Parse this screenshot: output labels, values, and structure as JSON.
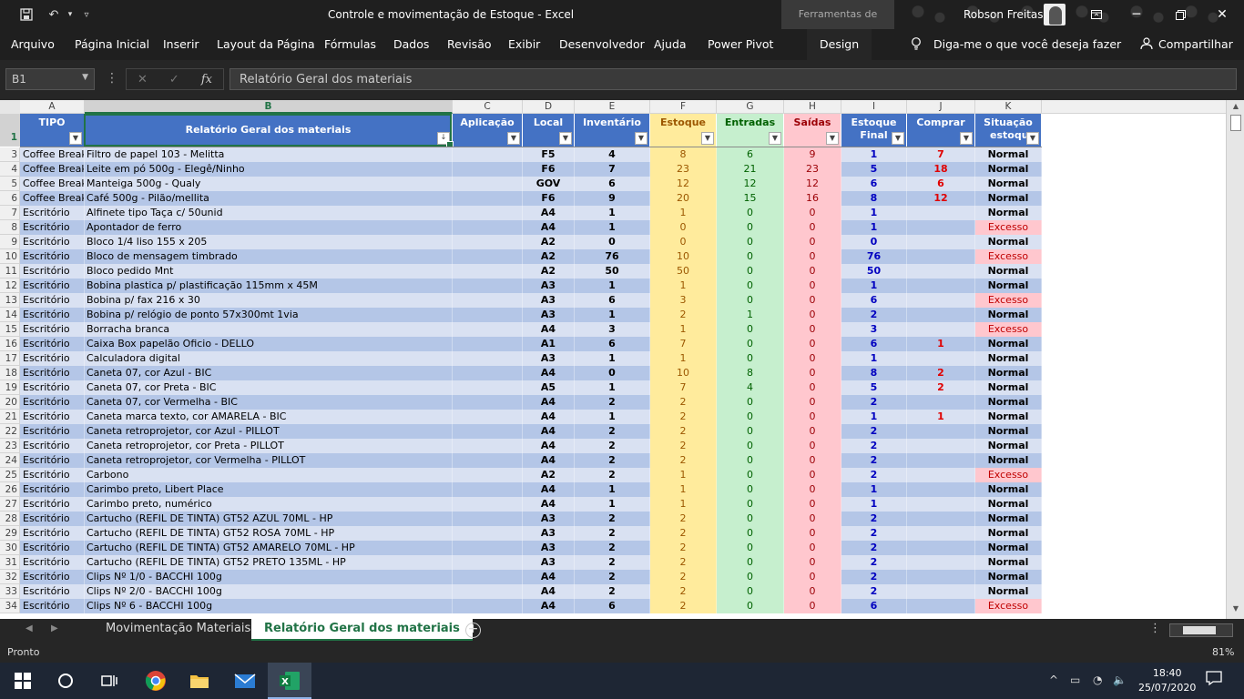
{
  "window": {
    "title": "Controle e movimentação de Estoque  -  Excel",
    "tools_tab": "Ferramentas de Tabela",
    "user": "Robson Freitas"
  },
  "ribbon": {
    "tabs": [
      "Arquivo",
      "Página Inicial",
      "Inserir",
      "Layout da Página",
      "Fórmulas",
      "Dados",
      "Revisão",
      "Exibir",
      "Desenvolvedor",
      "Ajuda",
      "Power Pivot",
      "Design"
    ],
    "tell_me": "Diga-me o que você deseja fazer",
    "share": "Compartilhar"
  },
  "formula_bar": {
    "name_box": "B1",
    "formula": "Relatório Geral dos materiais"
  },
  "columns": [
    "A",
    "B",
    "C",
    "D",
    "E",
    "F",
    "G",
    "H",
    "I",
    "J",
    "K"
  ],
  "table": {
    "headers": {
      "tipo": "TIPO",
      "relatorio": "Relatório Geral dos materiais",
      "aplicacao": "Aplicação",
      "local": "Local",
      "inventario": "Inventário",
      "estoque": "Estoque",
      "entradas": "Entradas",
      "saidas": "Saídas",
      "estoque_final": "Estoque Final",
      "comprar": "Comprar",
      "situacao_1": "Situação",
      "situacao_2": "estoque"
    },
    "rows": [
      {
        "n": "3",
        "tipo": "Coffee Break",
        "item": "Filtro de papel 103 - Melitta",
        "app": "",
        "loc": "F5",
        "inv": "4",
        "est": "8",
        "ent": "6",
        "sai": "9",
        "fin": "1",
        "comp": "7",
        "sit": "Normal"
      },
      {
        "n": "4",
        "tipo": "Coffee Break",
        "item": "Leite em pó 500g - Elegê/Ninho",
        "app": "",
        "loc": "F6",
        "inv": "7",
        "est": "23",
        "ent": "21",
        "sai": "23",
        "fin": "5",
        "comp": "18",
        "sit": "Normal"
      },
      {
        "n": "5",
        "tipo": "Coffee Break",
        "item": "Manteiga 500g - Qualy",
        "app": "",
        "loc": "GOV",
        "inv": "6",
        "est": "12",
        "ent": "12",
        "sai": "12",
        "fin": "6",
        "comp": "6",
        "sit": "Normal"
      },
      {
        "n": "6",
        "tipo": "Coffee Break",
        "item": "Café 500g - Pilão/mellita",
        "app": "",
        "loc": "F6",
        "inv": "9",
        "est": "20",
        "ent": "15",
        "sai": "16",
        "fin": "8",
        "comp": "12",
        "sit": "Normal"
      },
      {
        "n": "7",
        "tipo": "Escritório",
        "item": "Alfinete tipo Taça c/ 50unid",
        "app": "",
        "loc": "A4",
        "inv": "1",
        "est": "1",
        "ent": "0",
        "sai": "0",
        "fin": "1",
        "comp": "",
        "sit": "Normal"
      },
      {
        "n": "8",
        "tipo": "Escritório",
        "item": "Apontador de ferro",
        "app": "",
        "loc": "A4",
        "inv": "1",
        "est": "0",
        "ent": "0",
        "sai": "0",
        "fin": "1",
        "comp": "",
        "sit": "Excesso"
      },
      {
        "n": "9",
        "tipo": "Escritório",
        "item": "Bloco 1/4 liso 155 x 205",
        "app": "",
        "loc": "A2",
        "inv": "0",
        "est": "0",
        "ent": "0",
        "sai": "0",
        "fin": "0",
        "comp": "",
        "sit": "Normal"
      },
      {
        "n": "10",
        "tipo": "Escritório",
        "item": "Bloco de mensagem timbrado",
        "app": "",
        "loc": "A2",
        "inv": "76",
        "est": "10",
        "ent": "0",
        "sai": "0",
        "fin": "76",
        "comp": "",
        "sit": "Excesso"
      },
      {
        "n": "11",
        "tipo": "Escritório",
        "item": "Bloco pedido Mnt",
        "app": "",
        "loc": "A2",
        "inv": "50",
        "est": "50",
        "ent": "0",
        "sai": "0",
        "fin": "50",
        "comp": "",
        "sit": "Normal"
      },
      {
        "n": "12",
        "tipo": "Escritório",
        "item": "Bobina plastica p/ plastificação 115mm x 45M",
        "app": "",
        "loc": "A3",
        "inv": "1",
        "est": "1",
        "ent": "0",
        "sai": "0",
        "fin": "1",
        "comp": "",
        "sit": "Normal"
      },
      {
        "n": "13",
        "tipo": "Escritório",
        "item": "Bobina p/ fax 216 x 30",
        "app": "",
        "loc": "A3",
        "inv": "6",
        "est": "3",
        "ent": "0",
        "sai": "0",
        "fin": "6",
        "comp": "",
        "sit": "Excesso"
      },
      {
        "n": "14",
        "tipo": "Escritório",
        "item": "Bobina p/ relógio de ponto 57x300mt 1via",
        "app": "",
        "loc": "A3",
        "inv": "1",
        "est": "2",
        "ent": "1",
        "sai": "0",
        "fin": "2",
        "comp": "",
        "sit": "Normal"
      },
      {
        "n": "15",
        "tipo": "Escritório",
        "item": "Borracha branca",
        "app": "",
        "loc": "A4",
        "inv": "3",
        "est": "1",
        "ent": "0",
        "sai": "0",
        "fin": "3",
        "comp": "",
        "sit": "Excesso"
      },
      {
        "n": "16",
        "tipo": "Escritório",
        "item": "Caixa Box papelão Oficio - DELLO",
        "app": "",
        "loc": "A1",
        "inv": "6",
        "est": "7",
        "ent": "0",
        "sai": "0",
        "fin": "6",
        "comp": "1",
        "sit": "Normal"
      },
      {
        "n": "17",
        "tipo": "Escritório",
        "item": "Calculadora digital",
        "app": "",
        "loc": "A3",
        "inv": "1",
        "est": "1",
        "ent": "0",
        "sai": "0",
        "fin": "1",
        "comp": "",
        "sit": "Normal"
      },
      {
        "n": "18",
        "tipo": "Escritório",
        "item": "Caneta 07, cor Azul - BIC",
        "app": "",
        "loc": "A4",
        "inv": "0",
        "est": "10",
        "ent": "8",
        "sai": "0",
        "fin": "8",
        "comp": "2",
        "sit": "Normal"
      },
      {
        "n": "19",
        "tipo": "Escritório",
        "item": "Caneta 07, cor Preta - BIC",
        "app": "",
        "loc": "A5",
        "inv": "1",
        "est": "7",
        "ent": "4",
        "sai": "0",
        "fin": "5",
        "comp": "2",
        "sit": "Normal"
      },
      {
        "n": "20",
        "tipo": "Escritório",
        "item": "Caneta 07, cor Vermelha - BIC",
        "app": "",
        "loc": "A4",
        "inv": "2",
        "est": "2",
        "ent": "0",
        "sai": "0",
        "fin": "2",
        "comp": "",
        "sit": "Normal"
      },
      {
        "n": "21",
        "tipo": "Escritório",
        "item": "Caneta marca texto, cor AMARELA - BIC",
        "app": "",
        "loc": "A4",
        "inv": "1",
        "est": "2",
        "ent": "0",
        "sai": "0",
        "fin": "1",
        "comp": "1",
        "sit": "Normal"
      },
      {
        "n": "22",
        "tipo": "Escritório",
        "item": "Caneta retroprojetor, cor Azul - PILLOT",
        "app": "",
        "loc": "A4",
        "inv": "2",
        "est": "2",
        "ent": "0",
        "sai": "0",
        "fin": "2",
        "comp": "",
        "sit": "Normal"
      },
      {
        "n": "23",
        "tipo": "Escritório",
        "item": "Caneta retroprojetor, cor Preta - PILLOT",
        "app": "",
        "loc": "A4",
        "inv": "2",
        "est": "2",
        "ent": "0",
        "sai": "0",
        "fin": "2",
        "comp": "",
        "sit": "Normal"
      },
      {
        "n": "24",
        "tipo": "Escritório",
        "item": "Caneta retroprojetor, cor Vermelha - PILLOT",
        "app": "",
        "loc": "A4",
        "inv": "2",
        "est": "2",
        "ent": "0",
        "sai": "0",
        "fin": "2",
        "comp": "",
        "sit": "Normal"
      },
      {
        "n": "25",
        "tipo": "Escritório",
        "item": "Carbono",
        "app": "",
        "loc": "A2",
        "inv": "2",
        "est": "1",
        "ent": "0",
        "sai": "0",
        "fin": "2",
        "comp": "",
        "sit": "Excesso"
      },
      {
        "n": "26",
        "tipo": "Escritório",
        "item": "Carimbo preto, Libert Place",
        "app": "",
        "loc": "A4",
        "inv": "1",
        "est": "1",
        "ent": "0",
        "sai": "0",
        "fin": "1",
        "comp": "",
        "sit": "Normal"
      },
      {
        "n": "27",
        "tipo": "Escritório",
        "item": "Carimbo preto, numérico",
        "app": "",
        "loc": "A4",
        "inv": "1",
        "est": "1",
        "ent": "0",
        "sai": "0",
        "fin": "1",
        "comp": "",
        "sit": "Normal"
      },
      {
        "n": "28",
        "tipo": "Escritório",
        "item": "Cartucho (REFIL DE TINTA)  GT52 AZUL 70ML - HP",
        "app": "",
        "loc": "A3",
        "inv": "2",
        "est": "2",
        "ent": "0",
        "sai": "0",
        "fin": "2",
        "comp": "",
        "sit": "Normal"
      },
      {
        "n": "29",
        "tipo": "Escritório",
        "item": "Cartucho (REFIL DE TINTA) GT52 ROSA 70ML - HP",
        "app": "",
        "loc": "A3",
        "inv": "2",
        "est": "2",
        "ent": "0",
        "sai": "0",
        "fin": "2",
        "comp": "",
        "sit": "Normal"
      },
      {
        "n": "30",
        "tipo": "Escritório",
        "item": "Cartucho (REFIL DE TINTA) GT52 AMARELO 70ML - HP",
        "app": "",
        "loc": "A3",
        "inv": "2",
        "est": "2",
        "ent": "0",
        "sai": "0",
        "fin": "2",
        "comp": "",
        "sit": "Normal"
      },
      {
        "n": "31",
        "tipo": "Escritório",
        "item": "Cartucho (REFIL DE TINTA) GT52 PRETO 135ML - HP",
        "app": "",
        "loc": "A3",
        "inv": "2",
        "est": "2",
        "ent": "0",
        "sai": "0",
        "fin": "2",
        "comp": "",
        "sit": "Normal"
      },
      {
        "n": "32",
        "tipo": "Escritório",
        "item": "Clips Nº 1/0 - BACCHI 100g",
        "app": "",
        "loc": "A4",
        "inv": "2",
        "est": "2",
        "ent": "0",
        "sai": "0",
        "fin": "2",
        "comp": "",
        "sit": "Normal"
      },
      {
        "n": "33",
        "tipo": "Escritório",
        "item": "Clips Nº 2/0 - BACCHI 100g",
        "app": "",
        "loc": "A4",
        "inv": "2",
        "est": "2",
        "ent": "0",
        "sai": "0",
        "fin": "2",
        "comp": "",
        "sit": "Normal"
      },
      {
        "n": "34",
        "tipo": "Escritório",
        "item": "Clips Nº 6 - BACCHI 100g",
        "app": "",
        "loc": "A4",
        "inv": "6",
        "est": "2",
        "ent": "0",
        "sai": "0",
        "fin": "6",
        "comp": "",
        "sit": "Excesso"
      }
    ]
  },
  "sheets": [
    "Movimentação Materiais",
    "Relatório Geral dos materiais"
  ],
  "active_sheet": "Relatório Geral dos materiais",
  "status": {
    "ready": "Pronto",
    "zoom": "81%"
  },
  "taskbar": {
    "time": "18:40",
    "date": "25/07/2020"
  },
  "colors": {
    "header_blue": "#4472c4",
    "band_light": "#d9e1f2",
    "band_dark": "#b4c6e7",
    "excel_green": "#217346"
  }
}
